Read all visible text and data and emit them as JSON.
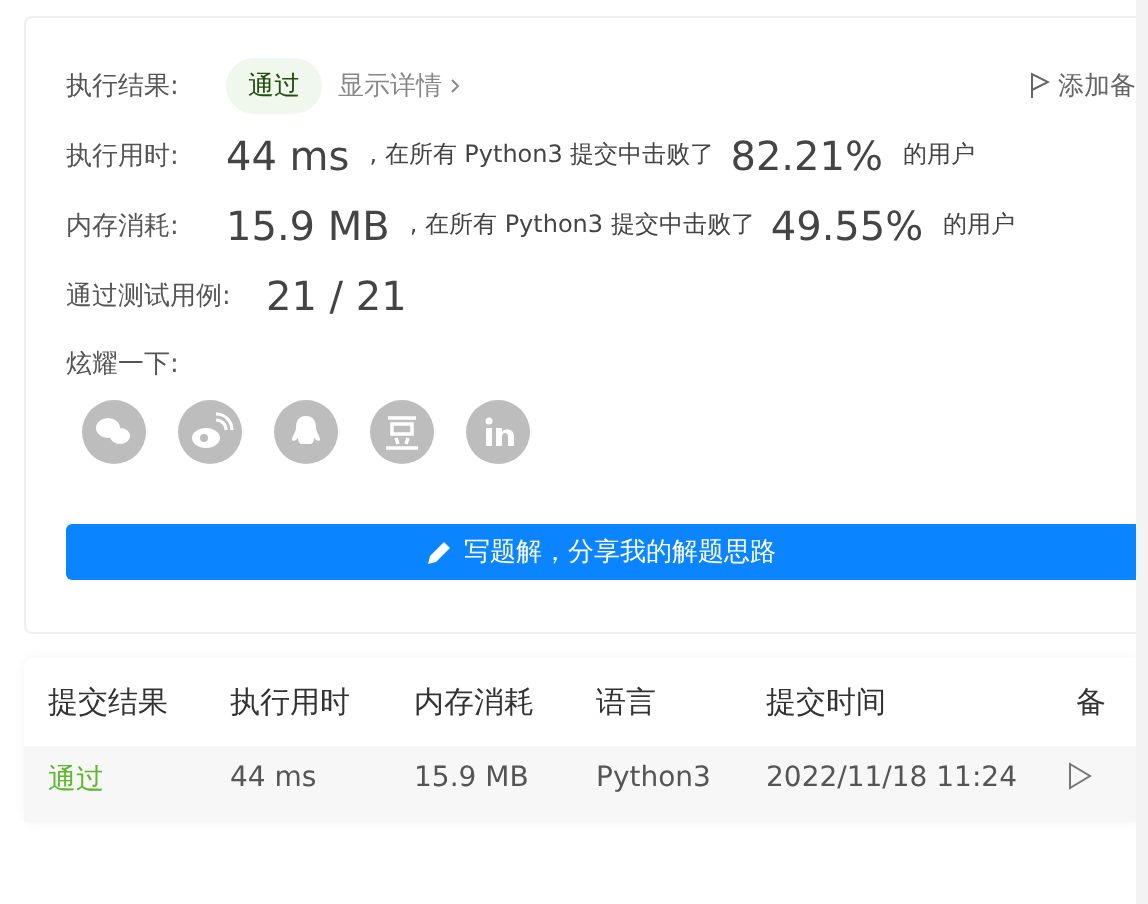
{
  "result": {
    "label": "执行结果:",
    "status": "通过",
    "details_link": "显示详情",
    "note_button": "添加备"
  },
  "stats": [
    {
      "label": "执行用时:",
      "value": "44 ms",
      "middle": ", 在所有 Python3 提交中击败了",
      "percent": "82.21%",
      "suffix": "的用户"
    },
    {
      "label": "内存消耗:",
      "value": "15.9 MB",
      "middle": ", 在所有 Python3 提交中击败了",
      "percent": "49.55%",
      "suffix": "的用户"
    }
  ],
  "tests": {
    "label": "通过测试用例:",
    "value": "21 / 21"
  },
  "share": {
    "label": "炫耀一下:",
    "icons": [
      {
        "kind": "wechat"
      },
      {
        "kind": "weibo"
      },
      {
        "kind": "qq"
      },
      {
        "kind": "douban"
      },
      {
        "kind": "linkedin"
      }
    ]
  },
  "write_button": "写题解，分享我的解题思路",
  "table": {
    "columns": [
      "提交结果",
      "执行用时",
      "内存消耗",
      "语言",
      "提交时间",
      "备"
    ],
    "rows": [
      {
        "result": "通过",
        "runtime": "44 ms",
        "memory": "15.9 MB",
        "language": "Python3",
        "time": "2022/11/18 11:24"
      }
    ]
  }
}
